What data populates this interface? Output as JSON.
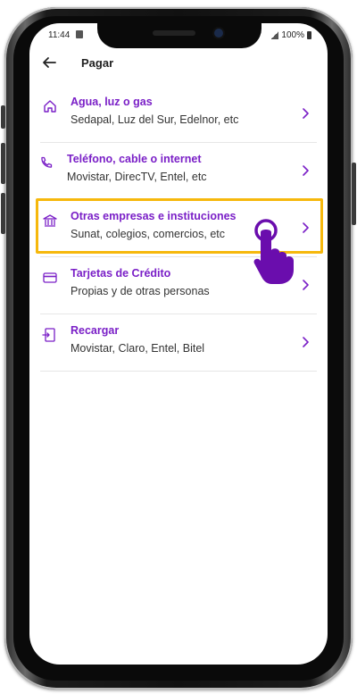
{
  "status_bar": {
    "time": "11:44",
    "battery": "100%"
  },
  "header": {
    "title": "Pagar"
  },
  "items": [
    {
      "title": "Agua, luz o gas",
      "subtitle": "Sedapal, Luz del Sur, Edelnor, etc",
      "icon": "home-icon"
    },
    {
      "title": "Teléfono, cable o internet",
      "subtitle": "Movistar, DirecTV, Entel, etc",
      "icon": "phone-icon"
    },
    {
      "title": "Otras empresas e instituciones",
      "subtitle": "Sunat, colegios, comercios, etc",
      "icon": "bank-icon"
    },
    {
      "title": "Tarjetas de Crédito",
      "subtitle": "Propias y de otras personas",
      "icon": "credit-card-icon"
    },
    {
      "title": "Recargar",
      "subtitle": "Movistar, Claro, Entel, Bitel",
      "icon": "phone-recharge-icon"
    }
  ],
  "colors": {
    "accent": "#7a1fc7",
    "highlight": "#f6b80c",
    "hand": "#6a0dad"
  }
}
